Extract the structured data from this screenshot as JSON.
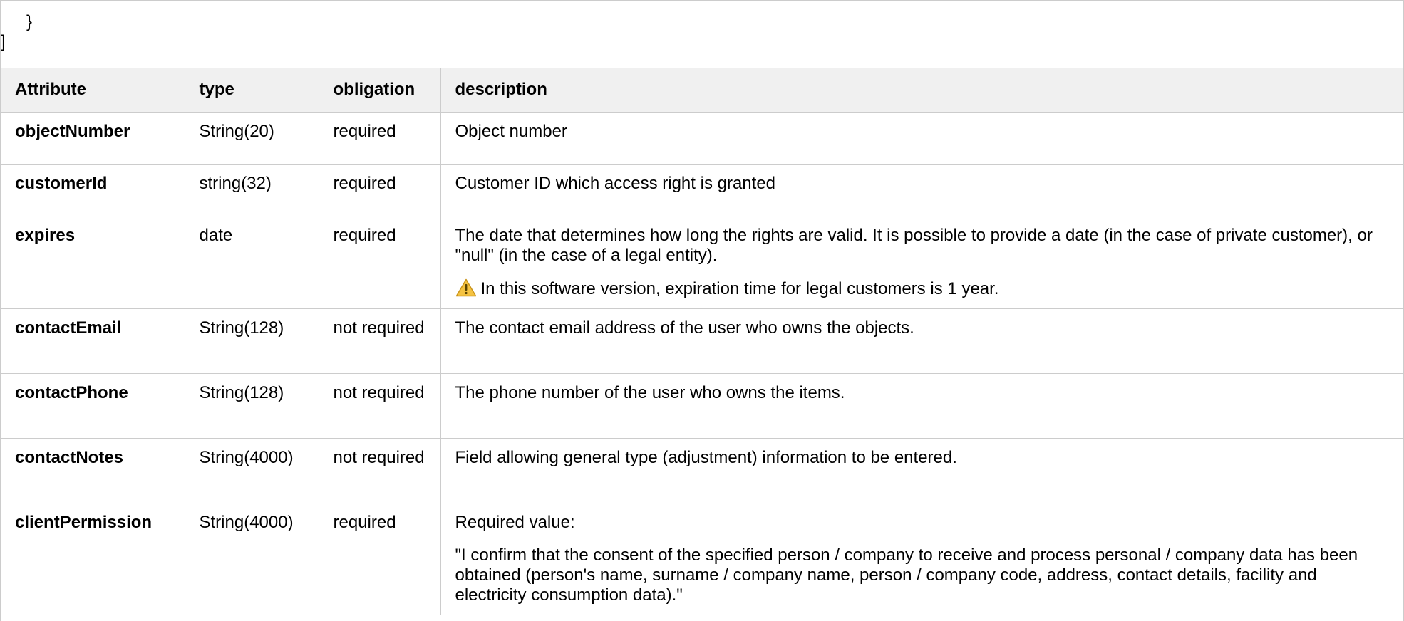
{
  "code_tail": {
    "line1": "}",
    "line2": "]"
  },
  "table": {
    "headers": [
      "Attribute",
      "type",
      "obligation",
      "description"
    ],
    "rows": [
      {
        "attribute": "objectNumber",
        "type": "String(20)",
        "obligation": "required",
        "description": [
          "Object number"
        ]
      },
      {
        "attribute": "customerId",
        "type": "string(32)",
        "obligation": "required",
        "description": [
          "Customer ID which access right is granted"
        ]
      },
      {
        "attribute": "expires",
        "type": "date",
        "obligation": "required",
        "description": [
          "The date that determines how long the rights are valid. It is possible to provide a date (in the case of private customer), or \"null\" (in the case of a legal entity)."
        ],
        "warning": "In this software version, expiration time for legal customers is 1 year."
      },
      {
        "attribute": "contactEmail",
        "type": "String(128)",
        "obligation": "not required",
        "description": [
          "The contact email address of the user who owns the objects."
        ]
      },
      {
        "attribute": "contactPhone",
        "type": "String(128)",
        "obligation": "not required",
        "description": [
          "The phone number of the user who owns the items."
        ]
      },
      {
        "attribute": "contactNotes",
        "type": "String(4000)",
        "obligation": "not required",
        "description": [
          "Field allowing general type (adjustment) information to be entered."
        ]
      },
      {
        "attribute": "clientPermission",
        "type": "String(4000)",
        "obligation": "required",
        "description": [
          "Required value:",
          "\"I confirm that the consent of the specified person / company to receive and process personal / company data has been obtained (person's name, surname / company name, person / company code, address, contact details, facility and electricity consumption data).\""
        ]
      }
    ]
  },
  "icons": {
    "warning": "warning-icon"
  },
  "colors": {
    "header_bg": "#f0f0f0",
    "border": "#cccccc",
    "warning_fill": "#f5c342",
    "warning_stroke": "#c9931a"
  }
}
